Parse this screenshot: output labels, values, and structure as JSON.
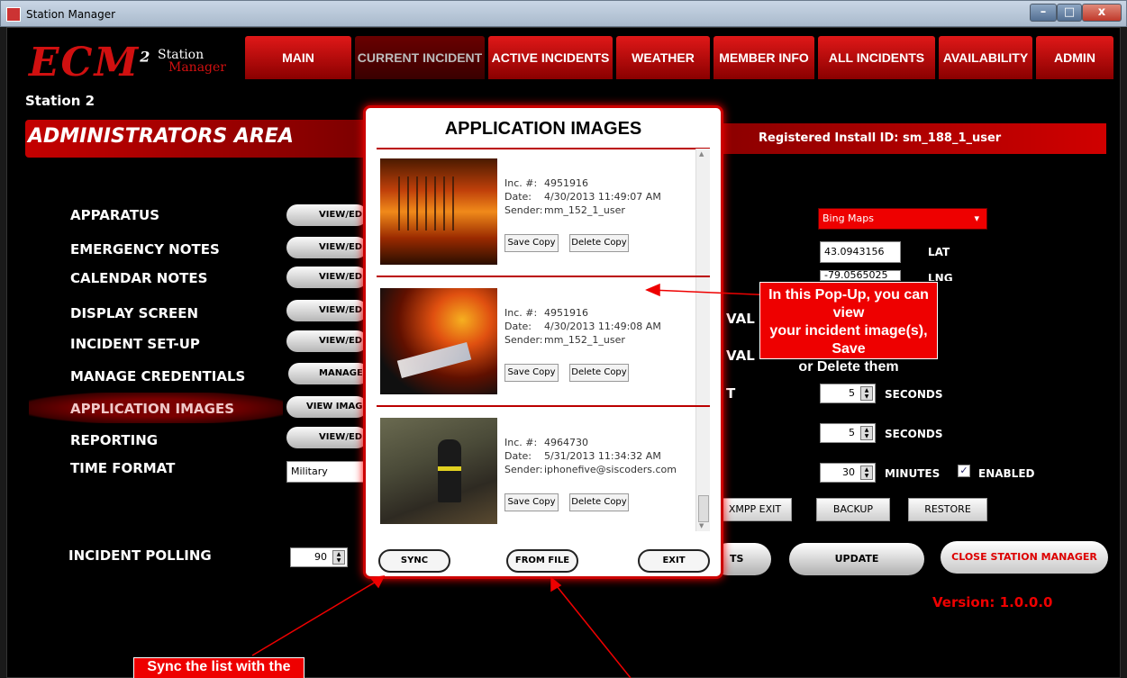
{
  "window": {
    "title": "Station Manager",
    "min": "–",
    "max": "□",
    "close": "x"
  },
  "header": {
    "logo": "ECM",
    "logo_sup": "2",
    "logo_sub_1": "Station",
    "logo_sub_2": "Manager",
    "tabs": [
      "MAIN",
      "CURRENT INCIDENT",
      "ACTIVE INCIDENTS",
      "WEATHER",
      "MEMBER INFO",
      "ALL INCIDENTS",
      "AVAILABILITY",
      "ADMIN"
    ]
  },
  "page": {
    "station": "Station 2",
    "title": "ADMINISTRATORS AREA",
    "registered": "Registered Install ID: sm_188_1_user"
  },
  "settings": [
    {
      "label": "APPARATUS",
      "button": "VIEW/EDIT"
    },
    {
      "label": "EMERGENCY NOTES",
      "button": "VIEW/EDIT"
    },
    {
      "label": "CALENDAR NOTES",
      "button": "VIEW/EDIT"
    },
    {
      "label": "DISPLAY SCREEN",
      "button": "VIEW/EDIT"
    },
    {
      "label": "INCIDENT SET-UP",
      "button": "VIEW/EDIT"
    },
    {
      "label": "MANAGE CREDENTIALS",
      "button": "MANAGE"
    },
    {
      "label": "APPLICATION IMAGES",
      "button": "VIEW IMAGES"
    },
    {
      "label": "REPORTING",
      "button": "VIEW/EDIT"
    }
  ],
  "time_format": {
    "label": "TIME FORMAT",
    "value": "Military"
  },
  "incident_polling": {
    "label": "INCIDENT POLLING",
    "value": "90"
  },
  "right_panel": {
    "map_provider": "Bing Maps",
    "lat_value": "43.0943156",
    "lat_label": "LAT",
    "lng_value": "-79.0565025",
    "lng_label": "LNG",
    "val_partial_1": "VAL",
    "val_partial_2": "VAL",
    "t_partial": "T",
    "ts_partial": "TS",
    "sec1_value": "5",
    "sec1_label": "SECONDS",
    "sec2_value": "5",
    "sec2_label": "SECONDS",
    "min_value": "30",
    "min_label": "MINUTES",
    "enabled_label": "ENABLED",
    "xmpp_exit": "XMPP EXIT",
    "backup": "BACKUP",
    "restore": "RESTORE",
    "update": "UPDATE",
    "close_sm": "CLOSE STATION MANAGER",
    "version": "Version:  1.0.0.0"
  },
  "modal": {
    "title": "APPLICATION IMAGES",
    "items": [
      {
        "inc_label": "Inc. #:",
        "inc": "4951916",
        "date_label": "Date:",
        "date": "4/30/2013 11:49:07 AM",
        "sender_label": "Sender:",
        "sender": "mm_152_1_user",
        "save": "Save Copy",
        "delete": "Delete Copy"
      },
      {
        "inc_label": "Inc. #:",
        "inc": "4951916",
        "date_label": "Date:",
        "date": "4/30/2013 11:49:08 AM",
        "sender_label": "Sender:",
        "sender": "mm_152_1_user",
        "save": "Save Copy",
        "delete": "Delete Copy"
      },
      {
        "inc_label": "Inc. #:",
        "inc": "4964730",
        "date_label": "Date:",
        "date": "5/31/2013 11:34:32 AM",
        "sender_label": "Sender:",
        "sender": "iphonefive@siscoders.com",
        "save": "Save Copy",
        "delete": "Delete Copy"
      }
    ],
    "sync": "SYNC",
    "from_file": "FROM FILE",
    "exit": "EXIT"
  },
  "callouts": {
    "popup": [
      "In this Pop-Up, you can view",
      "your incident image(s), Save",
      "or Delete them"
    ],
    "sync": "Sync the list with the"
  },
  "colors": {
    "accent": "#d00000",
    "dark": "#000000"
  }
}
